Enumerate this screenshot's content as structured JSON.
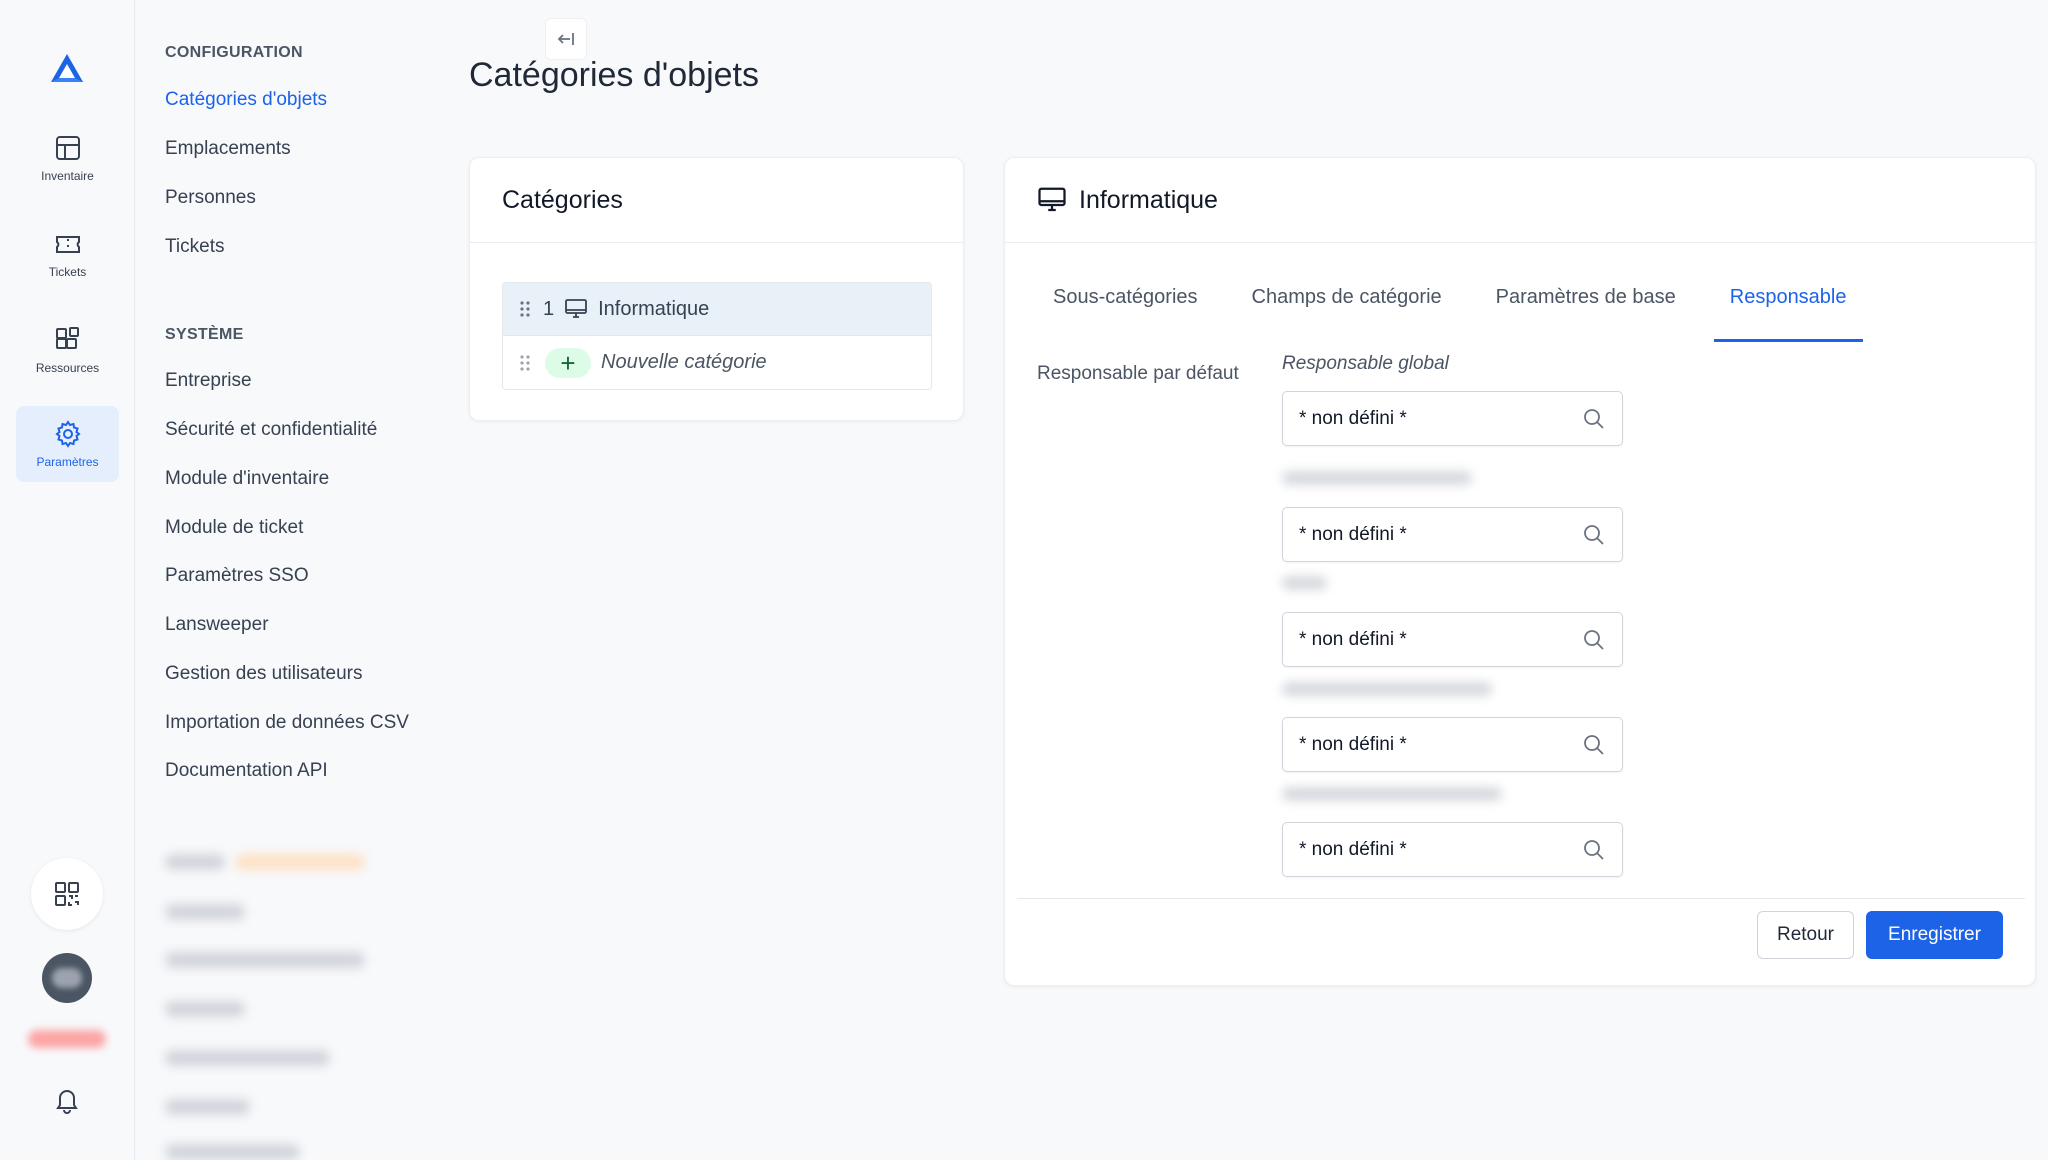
{
  "rail": {
    "items": [
      {
        "label": "Inventaire"
      },
      {
        "label": "Tickets"
      },
      {
        "label": "Ressources"
      },
      {
        "label": "Paramètres"
      }
    ]
  },
  "settings_nav": {
    "config_title": "CONFIGURATION",
    "config_items": [
      "Catégories d'objets",
      "Emplacements",
      "Personnes",
      "Tickets"
    ],
    "system_title": "SYSTÈME",
    "system_items": [
      "Entreprise",
      "Sécurité et confidentialité",
      "Module d'inventaire",
      "Module de ticket",
      "Paramètres SSO",
      "Lansweeper",
      "Gestion des utilisateurs",
      "Importation de données CSV",
      "Documentation API"
    ]
  },
  "page": {
    "title": "Catégories d'objets"
  },
  "categories_card": {
    "title": "Catégories",
    "items": [
      {
        "number": "1",
        "label": "Informatique"
      }
    ],
    "new_label": "Nouvelle catégorie"
  },
  "detail_card": {
    "title": "Informatique",
    "tabs": [
      "Sous-catégories",
      "Champs de catégorie",
      "Paramètres de base",
      "Responsable"
    ],
    "active_tab": "Responsable",
    "field_label": "Responsable par défaut",
    "global_label": "Responsable global",
    "fields": [
      {
        "value": "* non défini *"
      },
      {
        "value": "* non défini *"
      },
      {
        "value": "* non défini *"
      },
      {
        "value": "* non défini *"
      },
      {
        "value": "* non défini *"
      }
    ],
    "back_label": "Retour",
    "save_label": "Enregistrer"
  },
  "colors": {
    "accent": "#1d63e8",
    "background": "#f8f9fb"
  }
}
